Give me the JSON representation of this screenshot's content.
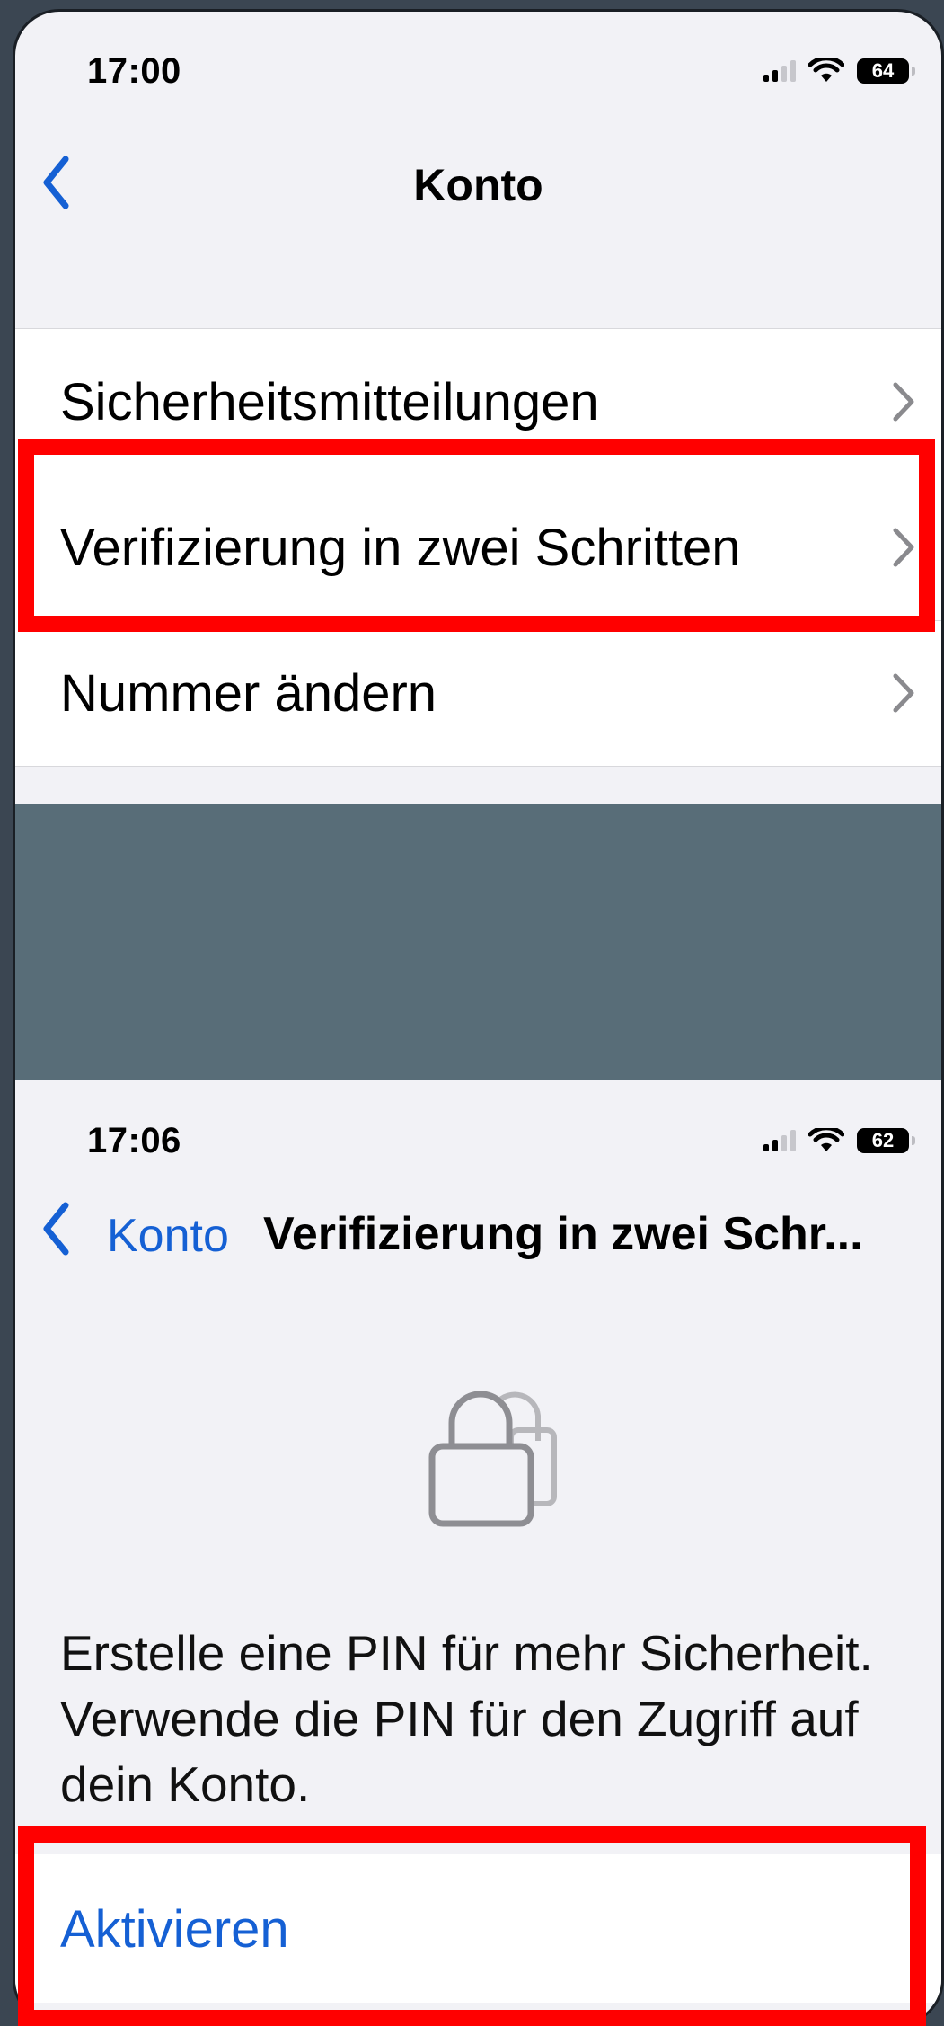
{
  "screen1": {
    "status": {
      "time": "17:00",
      "battery": "64"
    },
    "nav": {
      "title": "Konto"
    },
    "items": [
      {
        "label": "Sicherheitsmitteilungen"
      },
      {
        "label": "Verifizierung in zwei Schritten"
      },
      {
        "label": "Nummer ändern"
      }
    ]
  },
  "screen2": {
    "status": {
      "time": "17:06",
      "battery": "62"
    },
    "nav": {
      "back_label": "Konto",
      "title": "Verifizierung in zwei Schr..."
    },
    "icon": "lock-icon",
    "description": "Erstelle eine PIN für mehr Sicherheit. Verwende die PIN für den Zugriff auf dein Konto.",
    "action_label": "Aktivieren"
  },
  "colors": {
    "accent": "#1560d4",
    "highlight": "#ff0000",
    "background": "#f2f2f6",
    "divider_band": "#586d78"
  }
}
